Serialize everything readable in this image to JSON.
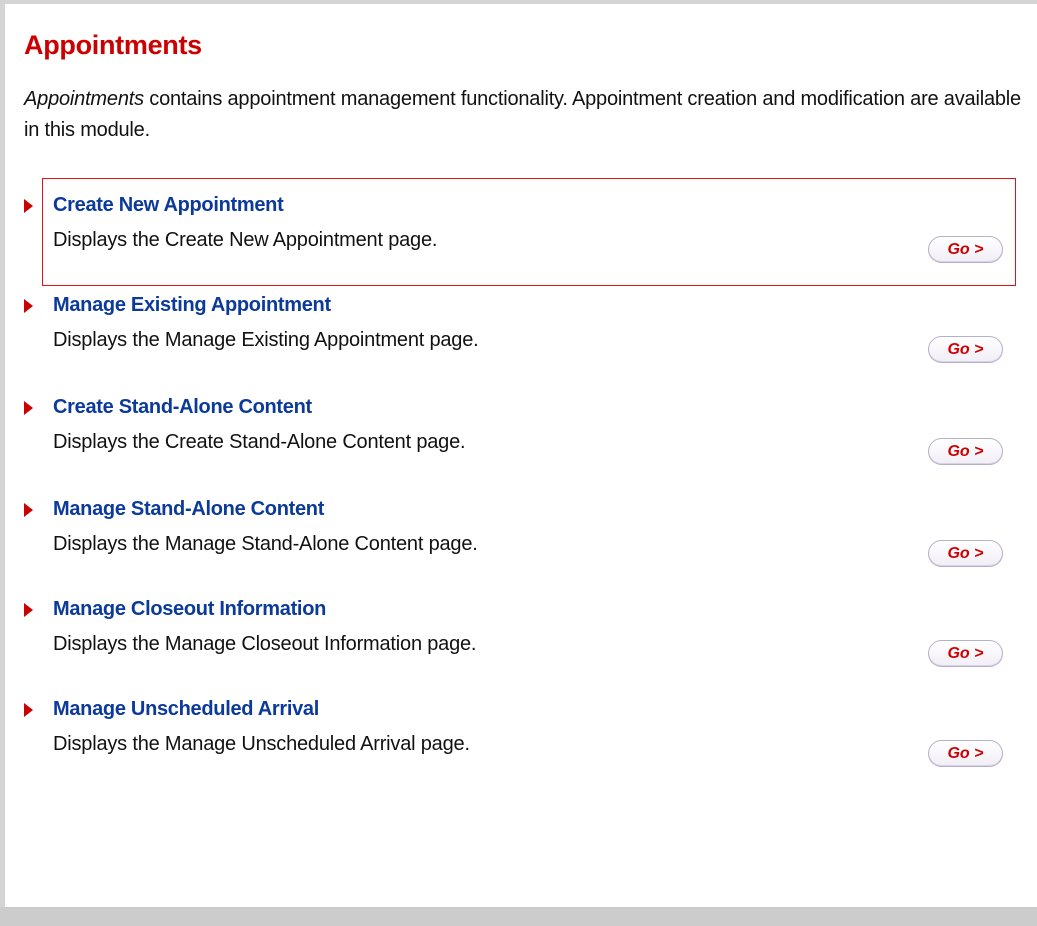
{
  "page": {
    "title": "Appointments",
    "intro_emphasis": "Appointments",
    "intro_text": " contains appointment management functionality. Appointment creation and modification are available in this module."
  },
  "icons": {
    "item_marker": "red-triangle-right-icon"
  },
  "colors": {
    "title": "#cc0000",
    "link": "#0b3a9a",
    "marker": "#cc0000",
    "selection_border": "#e0121b"
  },
  "items": [
    {
      "title": "Create New Appointment",
      "description": "Displays the Create New Appointment page.",
      "go_label": "Go >",
      "selected": true
    },
    {
      "title": "Manage Existing Appointment",
      "description": "Displays the Manage Existing Appointment page.",
      "go_label": "Go >",
      "selected": false
    },
    {
      "title": "Create Stand-Alone Content",
      "description": "Displays the Create Stand-Alone Content page.",
      "go_label": "Go >",
      "selected": false
    },
    {
      "title": "Manage Stand-Alone Content",
      "description": "Displays the Manage Stand-Alone Content page.",
      "go_label": "Go >",
      "selected": false
    },
    {
      "title": "Manage Closeout Information",
      "description": "Displays the Manage Closeout Information page.",
      "go_label": "Go >",
      "selected": false
    },
    {
      "title": "Manage Unscheduled Arrival",
      "description": "Displays the Manage Unscheduled Arrival page.",
      "go_label": "Go >",
      "selected": false
    }
  ]
}
